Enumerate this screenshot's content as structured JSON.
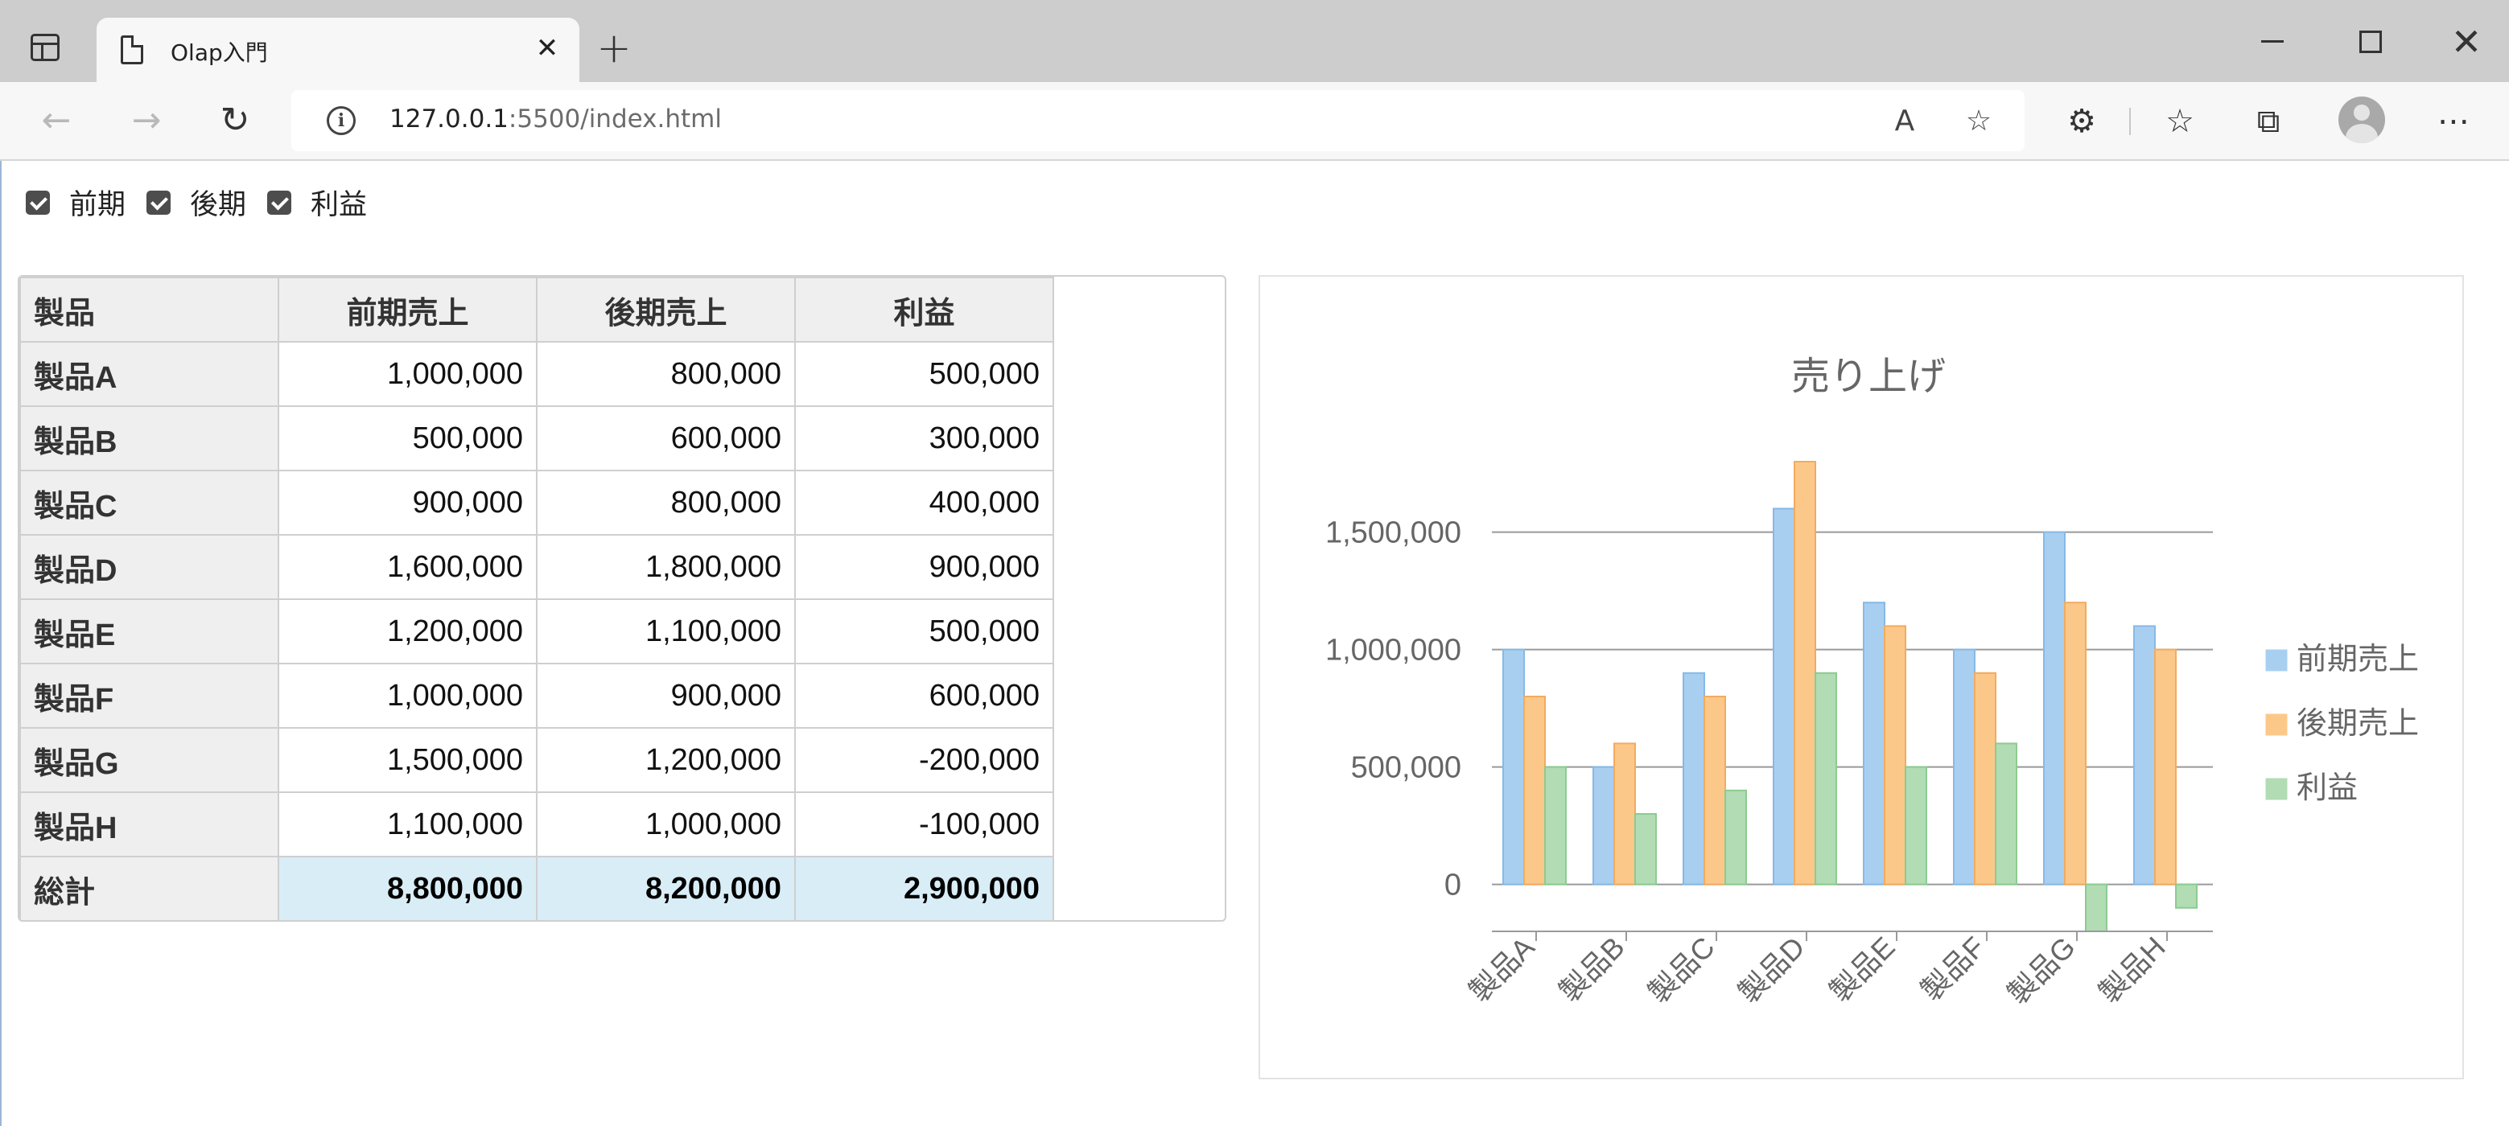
{
  "browser": {
    "tab_title": "Olap入門",
    "url_host": "127.0.0.1",
    "url_rest": ":5500/index.html"
  },
  "filters": [
    {
      "label": "前期",
      "checked": true
    },
    {
      "label": "後期",
      "checked": true
    },
    {
      "label": "利益",
      "checked": true
    }
  ],
  "table": {
    "headers": [
      "製品",
      "前期売上",
      "後期売上",
      "利益"
    ],
    "rows": [
      {
        "name": "製品A",
        "h1": "1,000,000",
        "h2": "800,000",
        "profit": "500,000"
      },
      {
        "name": "製品B",
        "h1": "500,000",
        "h2": "600,000",
        "profit": "300,000"
      },
      {
        "name": "製品C",
        "h1": "900,000",
        "h2": "800,000",
        "profit": "400,000"
      },
      {
        "name": "製品D",
        "h1": "1,600,000",
        "h2": "1,800,000",
        "profit": "900,000"
      },
      {
        "name": "製品E",
        "h1": "1,200,000",
        "h2": "1,100,000",
        "profit": "500,000"
      },
      {
        "name": "製品F",
        "h1": "1,000,000",
        "h2": "900,000",
        "profit": "600,000"
      },
      {
        "name": "製品G",
        "h1": "1,500,000",
        "h2": "1,200,000",
        "profit": "-200,000"
      },
      {
        "name": "製品H",
        "h1": "1,100,000",
        "h2": "1,000,000",
        "profit": "-100,000"
      }
    ],
    "total": {
      "name": "総計",
      "h1": "8,800,000",
      "h2": "8,200,000",
      "profit": "2,900,000"
    }
  },
  "chart_data": {
    "type": "bar",
    "title": "売り上げ",
    "categories": [
      "製品A",
      "製品B",
      "製品C",
      "製品D",
      "製品E",
      "製品F",
      "製品G",
      "製品H"
    ],
    "series": [
      {
        "name": "前期売上",
        "color": "#a9cff0",
        "values": [
          1000000,
          500000,
          900000,
          1600000,
          1200000,
          1000000,
          1500000,
          1100000
        ]
      },
      {
        "name": "後期売上",
        "color": "#fcc88a",
        "values": [
          800000,
          600000,
          800000,
          1800000,
          1100000,
          900000,
          1200000,
          1000000
        ]
      },
      {
        "name": "利益",
        "color": "#b1dcb4",
        "values": [
          500000,
          300000,
          400000,
          900000,
          500000,
          600000,
          -200000,
          -100000
        ]
      }
    ],
    "yticks": [
      0,
      500000,
      1000000,
      1500000
    ],
    "ytick_labels": [
      "0",
      "500,000",
      "1,000,000",
      "1,500,000"
    ],
    "ylim": [
      -200000,
      1800000
    ],
    "grid": true,
    "legend": "right"
  }
}
